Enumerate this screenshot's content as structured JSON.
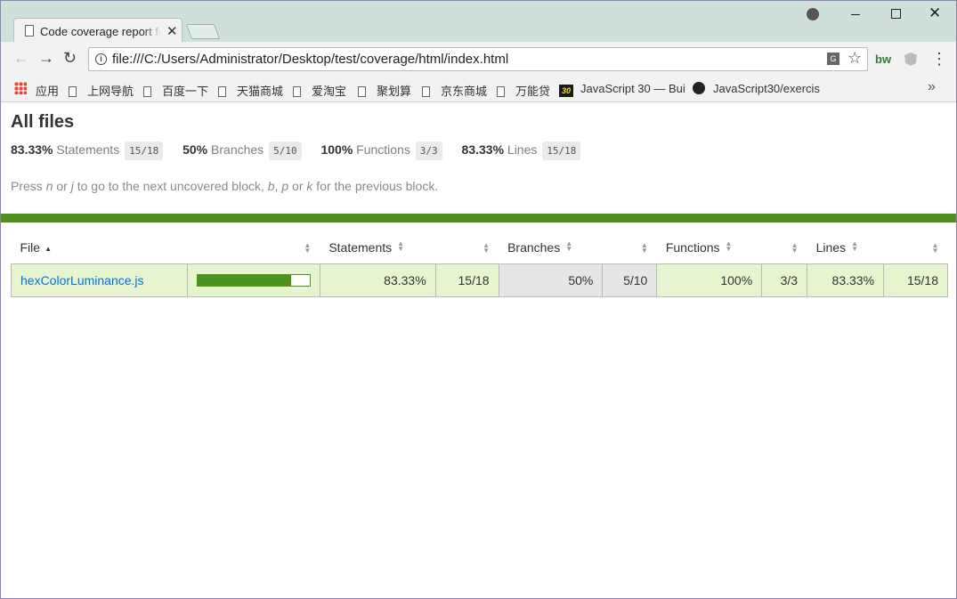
{
  "browser": {
    "tab_title": "Code coverage report for All files",
    "url": "file:///C:/Users/Administrator/Desktop/test/coverage/html/index.html",
    "extension_bw": "bw",
    "bookmarks": [
      "应用",
      "上网导航",
      "百度一下",
      "天猫商城",
      "爱淘宝",
      "聚划算",
      "京东商城",
      "万能贷",
      "JavaScript 30 — Bui",
      "JavaScript30/exercis"
    ],
    "js30_badge": "30"
  },
  "report": {
    "title": "All files",
    "metrics": [
      {
        "pct": "83.33%",
        "label": "Statements",
        "fraction": "15/18"
      },
      {
        "pct": "50%",
        "label": "Branches",
        "fraction": "5/10"
      },
      {
        "pct": "100%",
        "label": "Functions",
        "fraction": "3/3"
      },
      {
        "pct": "83.33%",
        "label": "Lines",
        "fraction": "15/18"
      }
    ],
    "hint": {
      "p1": "Press ",
      "k1": "n",
      "p2": " or ",
      "k2": "j",
      "p3": " to go to the next uncovered block, ",
      "k3": "b",
      "p4": ", ",
      "k4": "p",
      "p5": " or ",
      "k5": "k",
      "p6": " for the previous block."
    },
    "status_color": "#4d921d",
    "headers": {
      "file": "File",
      "statements": "Statements",
      "branches": "Branches",
      "functions": "Functions",
      "lines": "Lines"
    },
    "rows": [
      {
        "file": "hexColorLuminance.js",
        "coverage": 0.8333,
        "statements_pct": "83.33%",
        "statements_frac": "15/18",
        "branches_pct": "50%",
        "branches_frac": "5/10",
        "functions_pct": "100%",
        "functions_frac": "3/3",
        "lines_pct": "83.33%",
        "lines_frac": "15/18"
      }
    ]
  }
}
